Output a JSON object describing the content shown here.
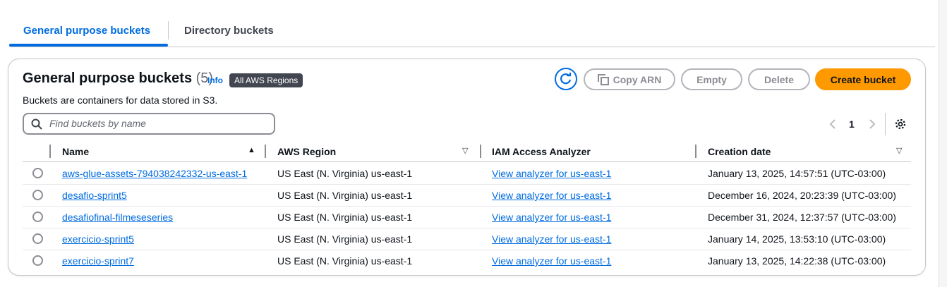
{
  "tabs": [
    {
      "label": "General purpose buckets",
      "active": true
    },
    {
      "label": "Directory buckets",
      "active": false
    }
  ],
  "panel": {
    "title": "General purpose buckets",
    "count": "(5)",
    "info": "Info",
    "region_badge": "All AWS Regions",
    "description": "Buckets are containers for data stored in S3."
  },
  "actions": {
    "refresh": "refresh-icon",
    "copy_arn": "Copy ARN",
    "empty": "Empty",
    "delete": "Delete",
    "create": "Create bucket"
  },
  "search": {
    "placeholder": "Find buckets by name",
    "value": ""
  },
  "pagination": {
    "page": "1"
  },
  "columns": [
    "Name",
    "AWS Region",
    "IAM Access Analyzer",
    "Creation date"
  ],
  "rows": [
    {
      "name": "aws-glue-assets-794038242332-us-east-1",
      "region": "US East (N. Virginia) us-east-1",
      "analyzer": "View analyzer for us-east-1",
      "date": "January 13, 2025, 14:57:51 (UTC-03:00)"
    },
    {
      "name": "desafio-sprint5",
      "region": "US East (N. Virginia) us-east-1",
      "analyzer": "View analyzer for us-east-1",
      "date": "December 16, 2024, 20:23:39 (UTC-03:00)"
    },
    {
      "name": "desafiofinal-filmeseseries",
      "region": "US East (N. Virginia) us-east-1",
      "analyzer": "View analyzer for us-east-1",
      "date": "December 31, 2024, 12:37:57 (UTC-03:00)"
    },
    {
      "name": "exercicio-sprint5",
      "region": "US East (N. Virginia) us-east-1",
      "analyzer": "View analyzer for us-east-1",
      "date": "January 14, 2025, 13:53:10 (UTC-03:00)"
    },
    {
      "name": "exercicio-sprint7",
      "region": "US East (N. Virginia) us-east-1",
      "analyzer": "View analyzer for us-east-1",
      "date": "January 13, 2025, 14:22:38 (UTC-03:00)"
    }
  ],
  "colors": {
    "accent": "#006ce0",
    "primary_button": "#ff9900"
  }
}
